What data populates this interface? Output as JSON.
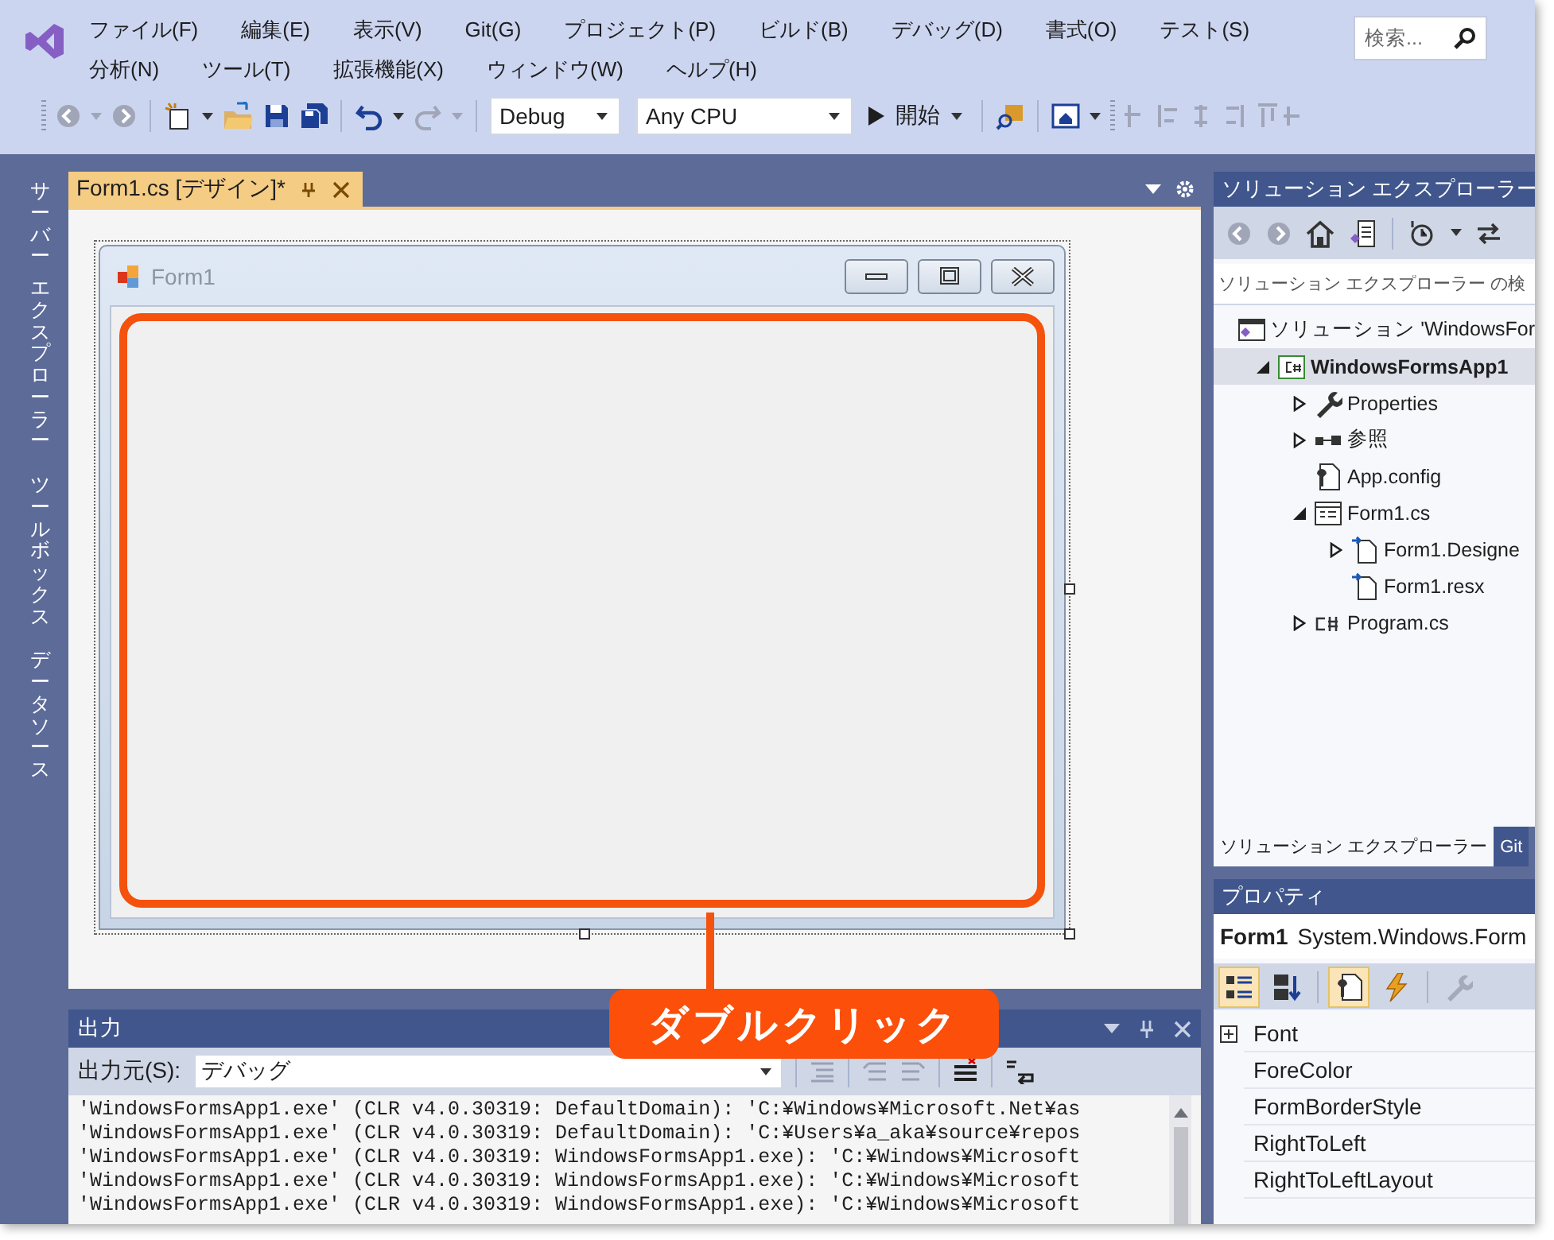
{
  "menu": [
    "ファイル(F)",
    "編集(E)",
    "表示(V)",
    "Git(G)",
    "プロジェクト(P)",
    "ビルド(B)",
    "デバッグ(D)",
    "書式(O)",
    "テスト(S)",
    "分析(N)",
    "ツール(T)",
    "拡張機能(X)",
    "ウィンドウ(W)",
    "ヘルプ(H)"
  ],
  "search": {
    "placeholder": "検索..."
  },
  "toolbar": {
    "configuration": "Debug",
    "platform": "Any CPU",
    "start": "開始"
  },
  "side_tabs": [
    {
      "words": [
        "サーバー",
        "エクスプローラー"
      ]
    },
    {
      "words": [
        "ツールボックス"
      ]
    },
    {
      "words": [
        "データソース"
      ]
    }
  ],
  "document_tab": {
    "label": "Form1.cs [デザイン]*",
    "selected": true
  },
  "form": {
    "title": "Form1"
  },
  "callout": {
    "text": "ダブルクリック"
  },
  "output": {
    "title": "出力",
    "source_label": "出力元(S):",
    "source": "デバッグ",
    "lines": [
      "'WindowsFormsApp1.exe' (CLR v4.0.30319: DefaultDomain): 'C:¥Windows¥Microsoft.Net¥as",
      "'WindowsFormsApp1.exe' (CLR v4.0.30319: DefaultDomain): 'C:¥Users¥a_aka¥source¥repos",
      "'WindowsFormsApp1.exe' (CLR v4.0.30319: WindowsFormsApp1.exe): 'C:¥Windows¥Microsoft",
      "'WindowsFormsApp1.exe' (CLR v4.0.30319: WindowsFormsApp1.exe): 'C:¥Windows¥Microsoft",
      "'WindowsFormsApp1.exe' (CLR v4.0.30319: WindowsFormsApp1.exe): 'C:¥Windows¥Microsoft"
    ]
  },
  "solution_explorer": {
    "title": "ソリューション エクスプローラー",
    "search_placeholder": "ソリューション エクスプローラー の検",
    "tree": [
      {
        "label": "ソリューション 'WindowsFor",
        "kind": "solution",
        "selected": false,
        "children": [
          {
            "label": "WindowsFormsApp1",
            "kind": "project",
            "selected": true,
            "expanded": true,
            "children": [
              {
                "label": "Properties",
                "kind": "wrench",
                "selected": false,
                "expanded": false
              },
              {
                "label": "参照",
                "kind": "reference",
                "selected": false,
                "expanded": false
              },
              {
                "label": "App.config",
                "kind": "config",
                "selected": false
              },
              {
                "label": "Form1.cs",
                "kind": "form",
                "selected": false,
                "expanded": true,
                "children": [
                  {
                    "label": "Form1.Designe",
                    "kind": "file",
                    "selected": false,
                    "expanded": false
                  },
                  {
                    "label": "Form1.resx",
                    "kind": "file",
                    "selected": false
                  }
                ]
              },
              {
                "label": "Program.cs",
                "kind": "csharp",
                "selected": false,
                "expanded": false
              }
            ]
          }
        ]
      }
    ]
  },
  "bottom_tabs": [
    {
      "label": "ソリューション エクスプローラー",
      "selected": true
    },
    {
      "label": "Git",
      "selected": false
    }
  ],
  "properties": {
    "title": "プロパティ",
    "object_name": "Form1",
    "object_type": "System.Windows.Form",
    "tool_buttons": [
      {
        "kind": "categorized",
        "selected": true
      },
      {
        "kind": "alphabetical",
        "selected": false
      },
      {
        "kind": "properties",
        "selected": true
      },
      {
        "kind": "events",
        "selected": false
      },
      {
        "kind": "pages",
        "selected": false
      }
    ],
    "rows": [
      {
        "name": "Font",
        "kind": "group",
        "expanded": false
      },
      {
        "name": "ForeColor",
        "kind": "value"
      },
      {
        "name": "FormBorderStyle",
        "kind": "value"
      },
      {
        "name": "RightToLeft",
        "kind": "value"
      },
      {
        "name": "RightToLeftLayout",
        "kind": "value"
      }
    ]
  }
}
